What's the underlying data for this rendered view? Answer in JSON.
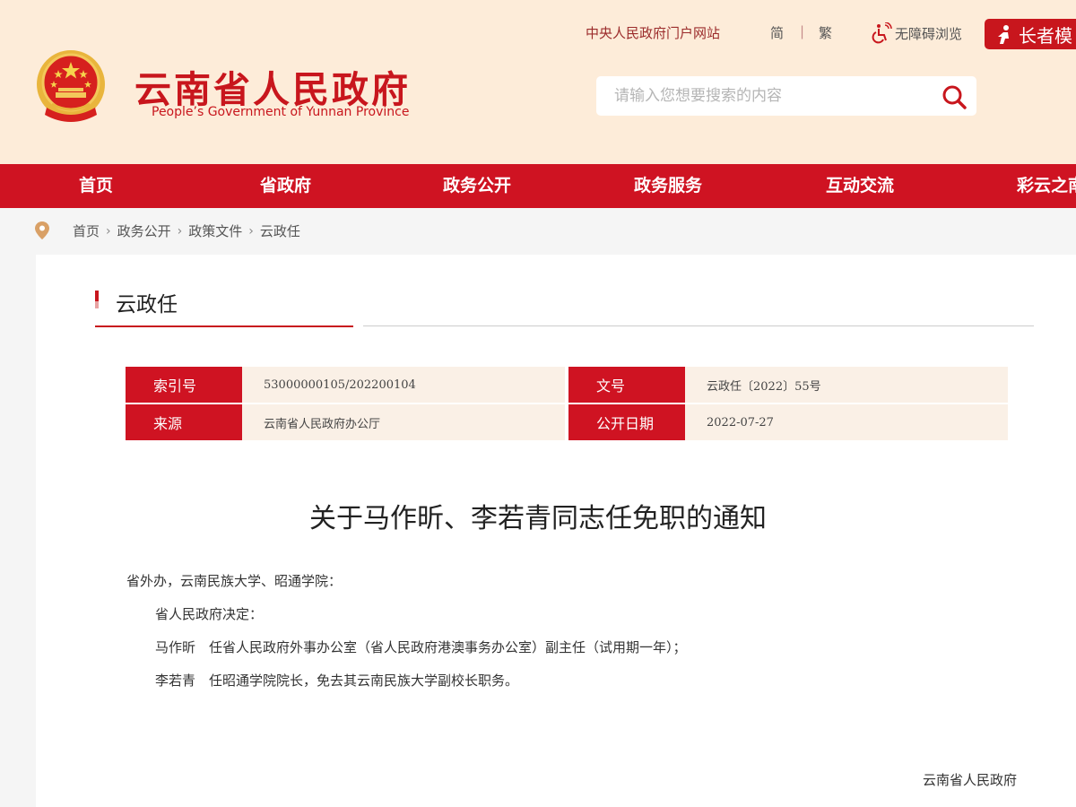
{
  "header": {
    "site_title": "云南省人民政府",
    "site_subtitle": "People’s Government of Yunnan Province",
    "top_links": {
      "portal": "中央人民政府门户网站",
      "simplified": "简",
      "separator": "|",
      "traditional": "繁",
      "accessibility": "无障碍浏览",
      "elder_mode": "长者模"
    },
    "search": {
      "placeholder": "请输入您想要搜索的内容"
    }
  },
  "nav": {
    "items": [
      {
        "label": "首页"
      },
      {
        "label": "省政府"
      },
      {
        "label": "政务公开"
      },
      {
        "label": "政务服务"
      },
      {
        "label": "互动交流"
      },
      {
        "label": "彩云之南"
      }
    ]
  },
  "breadcrumb": {
    "items": [
      "首页",
      "政务公开",
      "政策文件",
      "云政任"
    ]
  },
  "section": {
    "title": "云政任"
  },
  "meta": {
    "index_label": "索引号",
    "index_value": "53000000105/202200104",
    "doc_no_label": "文号",
    "doc_no_value": "云政任〔2022〕55号",
    "source_label": "来源",
    "source_value": "云南省人民政府办公厅",
    "date_label": "公开日期",
    "date_value": "2022-07-27"
  },
  "document": {
    "title": "关于马作昕、李若青同志任免职的通知",
    "addressee": "省外办，云南民族大学、昭通学院：",
    "paragraphs": [
      "省人民政府决定：",
      "马作昕　任省人民政府外事办公室（省人民政府港澳事务办公室）副主任（试用期一年）；",
      "李若青　任昭通学院院长，免去其云南民族大学副校长职务。"
    ],
    "signature": "云南省人民政府"
  },
  "colors": {
    "brand_red": "#cf1322",
    "header_bg": "#fdecd9",
    "meta_value_bg": "#faf0e6"
  }
}
